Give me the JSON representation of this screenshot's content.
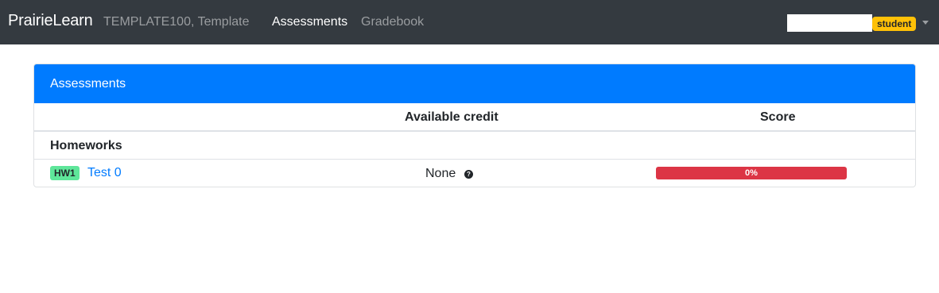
{
  "navbar": {
    "brand": "PrairieLearn",
    "course": "TEMPLATE100, Template",
    "links": [
      {
        "label": "Assessments",
        "active": true
      },
      {
        "label": "Gradebook",
        "active": false
      }
    ],
    "role_badge": "student",
    "colors": {
      "background": "#343a40",
      "badge": "#ffc107"
    }
  },
  "assessments": {
    "header": "Assessments",
    "columns": [
      "",
      "Available credit",
      "Score"
    ],
    "groups": [
      {
        "label": "Homeworks",
        "items": [
          {
            "badge": "HW1",
            "title": "Test 0",
            "credit": "None",
            "help_icon": "question-circle-icon",
            "score_label": "0%",
            "score_fraction": 1.0
          }
        ]
      }
    ],
    "colors": {
      "header": "#007bff",
      "score_bar": "#dc3545",
      "badge": "#5fe69a"
    }
  }
}
